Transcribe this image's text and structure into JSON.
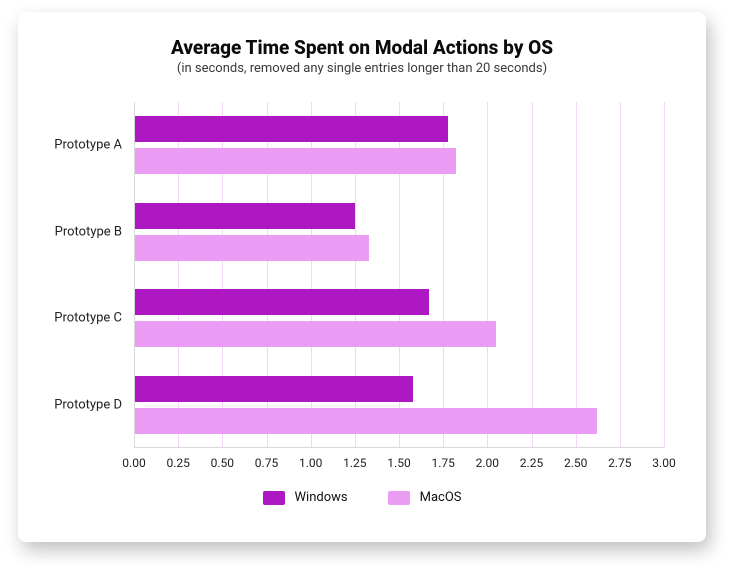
{
  "title": "Average Time Spent on Modal Actions by OS",
  "subtitle": "(in seconds, removed any single entries longer than 20 seconds)",
  "legend": {
    "windows": "Windows",
    "macos": "MacOS"
  },
  "colors": {
    "windows": "#ad18c3",
    "macos": "#eb9cf5",
    "grid": "#f1d6f7",
    "axis": "#d9d9dd"
  },
  "chart_data": {
    "type": "bar",
    "orientation": "horizontal",
    "categories": [
      "Prototype A",
      "Prototype B",
      "Prototype C",
      "Prototype D"
    ],
    "series": [
      {
        "name": "Windows",
        "values": [
          1.78,
          1.25,
          1.67,
          1.58
        ]
      },
      {
        "name": "MacOS",
        "values": [
          1.82,
          1.33,
          2.05,
          2.62
        ]
      }
    ],
    "xlabel": "",
    "ylabel": "",
    "xlim": [
      0.0,
      3.0
    ],
    "xticks": [
      0.0,
      0.25,
      0.5,
      0.75,
      1.0,
      1.25,
      1.5,
      1.75,
      2.0,
      2.25,
      2.5,
      2.75,
      3.0
    ],
    "grid": true,
    "legend_position": "bottom"
  }
}
